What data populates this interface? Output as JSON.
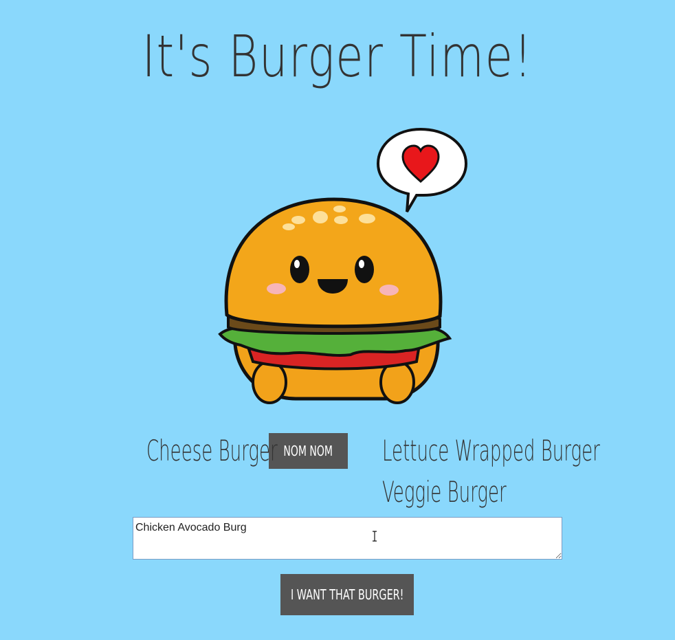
{
  "header": {
    "title": "It's Burger Time!"
  },
  "menu": {
    "devoured": [
      {
        "name": "Cheese Burger",
        "button_label": "NOM NOM"
      }
    ],
    "eaten": [
      {
        "name": "Lettuce Wrapped Burger"
      },
      {
        "name": "Veggie Burger"
      }
    ]
  },
  "form": {
    "input_value": "Chicken Avocado Burg",
    "submit_label": "I WANT THAT BURGER!"
  },
  "illustration": {
    "icon": "cute-burger-with-heart-bubble"
  },
  "colors": {
    "background": "#8ad8fc",
    "button": "#555555",
    "text": "#333333"
  }
}
